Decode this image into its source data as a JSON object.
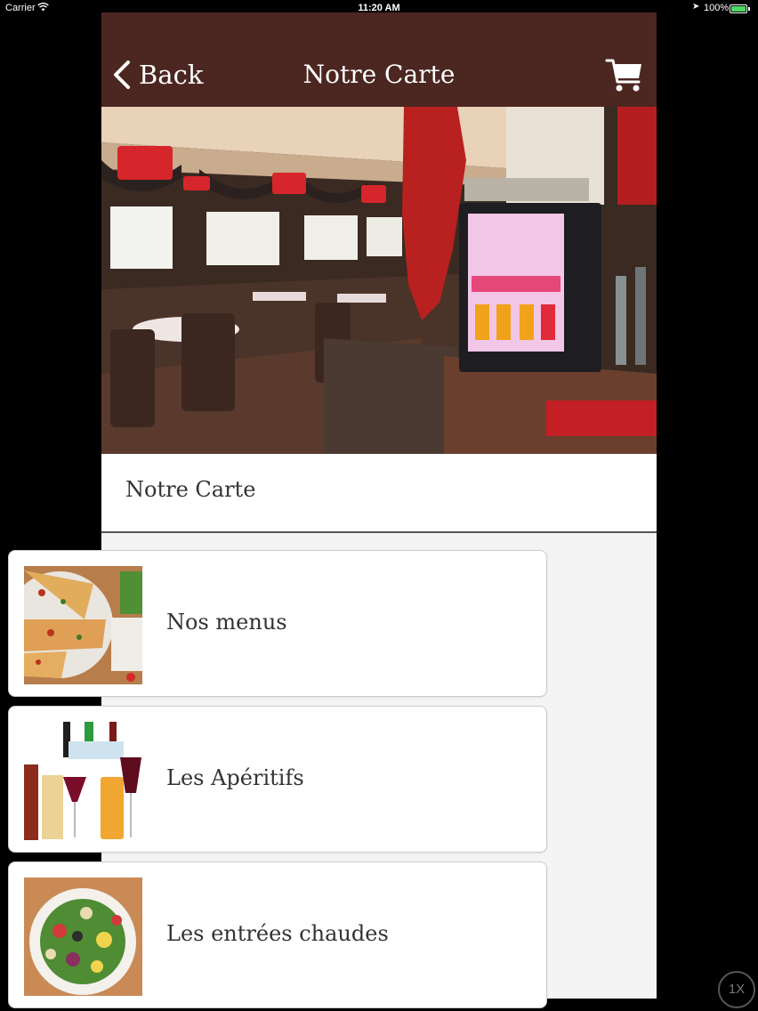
{
  "status_bar": {
    "carrier": "Carrier",
    "time": "11:20 AM",
    "battery": "100%"
  },
  "navbar": {
    "back_label": "Back",
    "title": "Notre Carte",
    "cart_icon": "cart-icon",
    "background": "#4c2620"
  },
  "hero": {
    "image": "restaurant-interior-photo"
  },
  "section": {
    "title": "Notre Carte"
  },
  "menu_items": [
    {
      "label": "Nos menus",
      "thumb": "pizza-photo"
    },
    {
      "label": "Les Apéritifs",
      "thumb": "drinks-photo"
    },
    {
      "label": "Les entrées chaudes",
      "thumb": "salad-photo"
    }
  ],
  "zoom_badge": "1X"
}
